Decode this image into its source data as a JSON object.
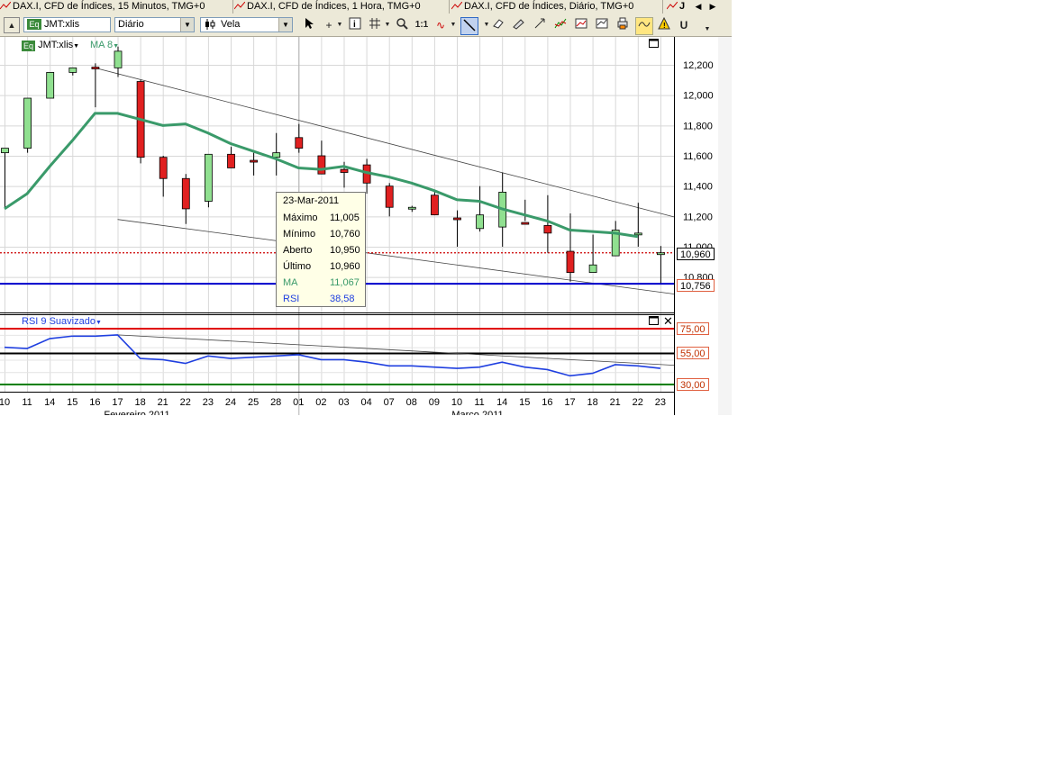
{
  "tabs": [
    {
      "label": "DAX.I, CFD de Índices, 15 Minutos, TMG+0"
    },
    {
      "label": "DAX.I, CFD de Índices, 1 Hora, TMG+0"
    },
    {
      "label": "DAX.I, CFD de Índices, Diário, TMG+0"
    },
    {
      "label": "J"
    }
  ],
  "toolbar": {
    "symbol_value": "JMT:xlis",
    "interval_value": "Diário",
    "chart_type_value": "Vela",
    "one_to_one_label": "1:1"
  },
  "colors": {
    "candle_up": "#90e090",
    "candle_down": "#e02020",
    "ma_line": "#3a9a6a",
    "rsi_line": "#1f3fe0",
    "accent_blue": "#0000cc"
  },
  "chart": {
    "instrument_label": "JMT:xlis",
    "ma_label": "MA 8",
    "price_axis": [
      "12,200",
      "12,000",
      "11,800",
      "11,600",
      "11,400",
      "11,200",
      "11,000",
      "10,800"
    ],
    "last_price_badge": "10,960",
    "hline_badge": "10,756",
    "x_days": [
      "10",
      "11",
      "14",
      "15",
      "16",
      "17",
      "18",
      "21",
      "22",
      "23",
      "24",
      "25",
      "28",
      "01",
      "02",
      "03",
      "04",
      "07",
      "08",
      "09",
      "10",
      "11",
      "14",
      "15",
      "16",
      "17",
      "18",
      "21",
      "22",
      "23"
    ],
    "x_months": [
      "Fevereiro 2011",
      "Março 2011"
    ]
  },
  "chart_data": {
    "type": "candlestick",
    "x": [
      "10-Feb",
      "11-Feb",
      "14-Feb",
      "15-Feb",
      "16-Feb",
      "17-Feb",
      "18-Feb",
      "21-Feb",
      "22-Feb",
      "23-Feb",
      "24-Feb",
      "25-Feb",
      "28-Feb",
      "01-Mar",
      "02-Mar",
      "03-Mar",
      "04-Mar",
      "07-Mar",
      "08-Mar",
      "09-Mar",
      "10-Mar",
      "11-Mar",
      "14-Mar",
      "15-Mar",
      "16-Mar",
      "17-Mar",
      "18-Mar",
      "21-Mar",
      "22-Mar",
      "23-Mar"
    ],
    "open": [
      11620,
      11650,
      11980,
      12150,
      12185,
      12180,
      12090,
      11590,
      11450,
      11300,
      11610,
      11570,
      11590,
      11720,
      11600,
      11510,
      11540,
      11400,
      11250,
      11340,
      11190,
      11120,
      11130,
      11160,
      11140,
      10970,
      10830,
      10940,
      11080,
      10950
    ],
    "high": [
      11650,
      11720,
      12060,
      12180,
      12210,
      12320,
      12100,
      11600,
      11480,
      11520,
      11660,
      11620,
      11750,
      11810,
      11700,
      11560,
      11580,
      11420,
      11270,
      11360,
      11240,
      11400,
      11490,
      11310,
      11340,
      11220,
      11080,
      11170,
      11290,
      11005
    ],
    "low": [
      11250,
      11620,
      11980,
      12130,
      11920,
      12120,
      11550,
      11330,
      11150,
      11260,
      11520,
      11470,
      11470,
      11620,
      11550,
      11390,
      11350,
      11200,
      11230,
      11220,
      11000,
      11100,
      11000,
      11170,
      10960,
      10770,
      10840,
      10940,
      11000,
      10760
    ],
    "close": [
      11650,
      11980,
      12150,
      12180,
      12180,
      12290,
      11590,
      11450,
      11250,
      11610,
      11520,
      11560,
      11620,
      11650,
      11480,
      11490,
      11420,
      11260,
      11260,
      11210,
      11180,
      11210,
      11360,
      11150,
      11090,
      10830,
      10880,
      11110,
      11090,
      10960
    ],
    "ma8": [
      11250,
      11350,
      11530,
      11700,
      11880,
      11880,
      11840,
      11800,
      11810,
      11750,
      11680,
      11630,
      11580,
      11520,
      11510,
      11530,
      11490,
      11460,
      11420,
      11370,
      11310,
      11300,
      11250,
      11210,
      11170,
      11110,
      11100,
      11090,
      11067
    ],
    "trendlines_price": [
      {
        "from": [
          "16-Feb",
          12180
        ],
        "to": [
          "23-Mar",
          11220
        ]
      },
      {
        "from": [
          "17-Feb",
          11180
        ],
        "to": [
          "21-Mar",
          10740
        ]
      }
    ],
    "horizontal_line": 10756,
    "last_price": 10960,
    "ylim": [
      10740,
      12340
    ],
    "rsi": {
      "name": "RSI 9 Suavizado",
      "values": [
        60,
        59,
        67,
        69,
        69,
        70,
        51,
        50,
        47,
        53,
        51,
        52,
        53,
        54,
        50,
        50,
        48,
        45,
        45,
        44,
        43,
        44,
        48,
        44,
        42,
        37,
        39,
        46,
        45,
        43
      ],
      "levels": [
        75,
        55,
        30
      ],
      "ylim": [
        20,
        80
      ]
    },
    "tooltip": {
      "date": "23-Mar-2011",
      "Máximo": "11,005",
      "Mínimo": "10,760",
      "Aberto": "10,950",
      "Último": "10,960",
      "MA": "11,067",
      "RSI": "38,58"
    },
    "rsi_level_badges": [
      "75,00",
      "55,00",
      "30,00"
    ]
  },
  "tooltip": {
    "date": "23-Mar-2011",
    "rows": [
      {
        "label": "Máximo",
        "value": "11,005"
      },
      {
        "label": "Mínimo",
        "value": "10,760"
      },
      {
        "label": "Aberto",
        "value": "10,950"
      },
      {
        "label": "Último",
        "value": "10,960"
      },
      {
        "label": "MA",
        "value": "11,067"
      },
      {
        "label": "RSI",
        "value": "38,58"
      }
    ]
  },
  "rsi_panel": {
    "label": "RSI 9 Suavizado",
    "badges": [
      "75,00",
      "55,00",
      "30,00"
    ]
  }
}
